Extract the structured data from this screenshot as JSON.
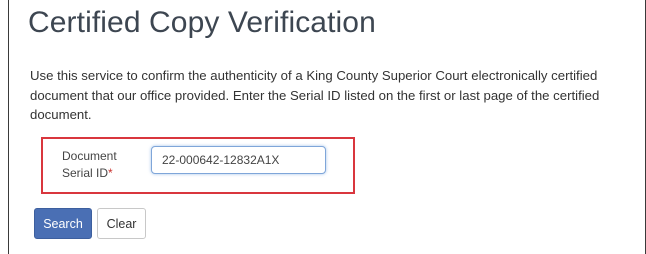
{
  "page": {
    "title": "Certified Copy Verification",
    "intro": "Use this service to confirm the authenticity of a King County Superior Court electronically certified document that our office provided. Enter the Serial ID listed on the first or last page of the certified document."
  },
  "form": {
    "serial_label": "Document Serial ID",
    "required_marker": "*",
    "serial_value": "22-000642-12832A1X"
  },
  "buttons": {
    "search_label": "Search",
    "clear_label": "Clear"
  },
  "colors": {
    "highlight_border": "#d9363e",
    "primary_button": "#4a6fb4",
    "title_text": "#3d4651"
  }
}
